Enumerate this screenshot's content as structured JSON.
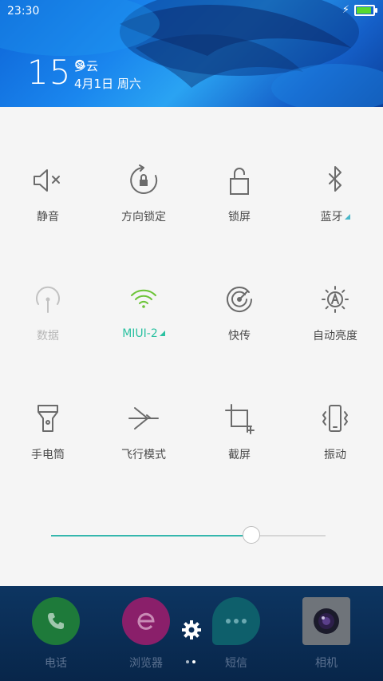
{
  "status_bar": {
    "time": "23:30",
    "battery_level": 1.0,
    "charging_icon": "bolt-icon"
  },
  "weather": {
    "temperature": "15°",
    "condition": "多云",
    "date": "4月1日 周六"
  },
  "toggles": [
    {
      "id": "mute",
      "label": "静音",
      "icon": "mute-icon"
    },
    {
      "id": "rotation-lock",
      "label": "方向锁定",
      "icon": "rotation-lock-icon"
    },
    {
      "id": "lock-screen",
      "label": "锁屏",
      "icon": "lock-icon"
    },
    {
      "id": "bluetooth",
      "label": "蓝牙",
      "icon": "bluetooth-icon"
    },
    {
      "id": "data",
      "label": "数据",
      "icon": "data-icon"
    },
    {
      "id": "wifi",
      "label": "MIUI-2",
      "icon": "wifi-icon"
    },
    {
      "id": "quick-transfer",
      "label": "快传",
      "icon": "quick-transfer-icon"
    },
    {
      "id": "auto-brightness",
      "label": "自动亮度",
      "icon": "auto-brightness-icon"
    },
    {
      "id": "flashlight",
      "label": "手电筒",
      "icon": "flashlight-icon"
    },
    {
      "id": "airplane-mode",
      "label": "飞行模式",
      "icon": "airplane-icon"
    },
    {
      "id": "screenshot",
      "label": "截屏",
      "icon": "crop-icon"
    },
    {
      "id": "vibrate",
      "label": "振动",
      "icon": "vibrate-icon"
    }
  ],
  "brightness": {
    "level": 0.73
  },
  "colors": {
    "accent": "#2cc1a1",
    "panel": "#f5f5f5",
    "icon": "#6b6b6b",
    "disabled": "#b7b7b7"
  },
  "dock": {
    "apps": [
      {
        "label": "电话",
        "icon": "phone-icon"
      },
      {
        "label": "浏览器",
        "icon": "browser-icon"
      },
      {
        "label": "短信",
        "icon": "messages-icon"
      },
      {
        "label": "相机",
        "icon": "camera-icon"
      }
    ],
    "settings_icon": "gear-icon",
    "page": 2,
    "page_count": 2
  }
}
